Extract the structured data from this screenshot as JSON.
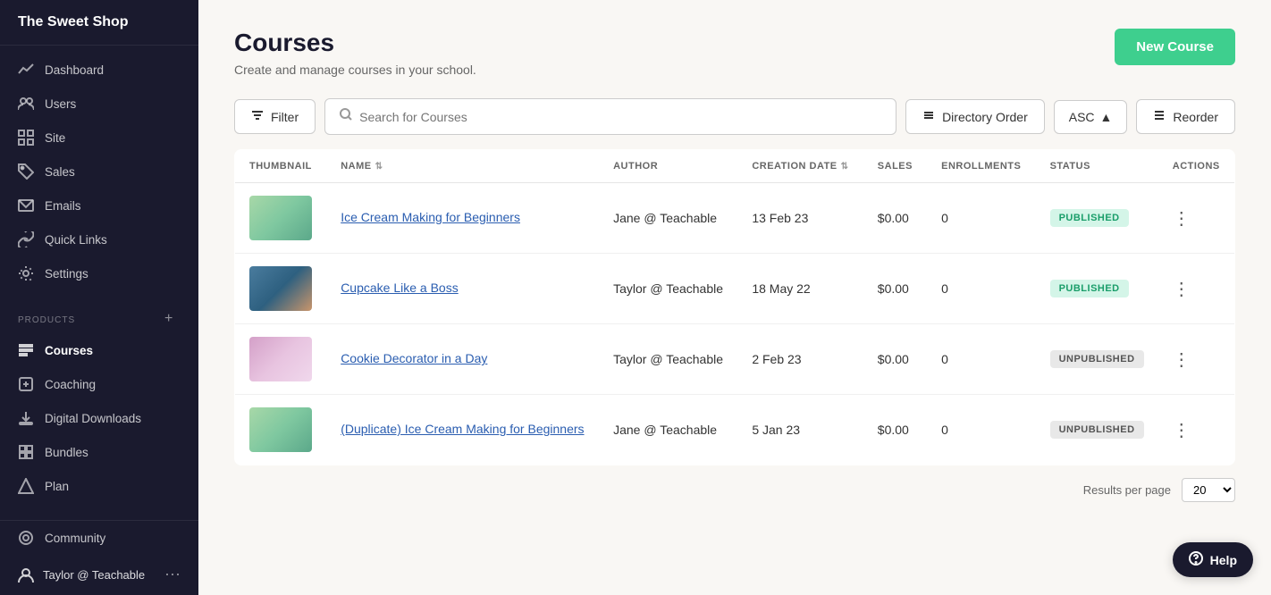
{
  "sidebar": {
    "logo": "The Sweet Shop",
    "nav_items": [
      {
        "id": "dashboard",
        "label": "Dashboard",
        "icon": "chart-line"
      },
      {
        "id": "users",
        "label": "Users",
        "icon": "users"
      },
      {
        "id": "site",
        "label": "Site",
        "icon": "grid"
      },
      {
        "id": "sales",
        "label": "Sales",
        "icon": "tag"
      },
      {
        "id": "emails",
        "label": "Emails",
        "icon": "email"
      },
      {
        "id": "quick-links",
        "label": "Quick Links",
        "icon": "link"
      },
      {
        "id": "settings",
        "label": "Settings",
        "icon": "gear"
      }
    ],
    "products_label": "PRODUCTS",
    "products_items": [
      {
        "id": "courses",
        "label": "Courses",
        "icon": "courses",
        "active": true
      },
      {
        "id": "coaching",
        "label": "Coaching",
        "icon": "coaching"
      },
      {
        "id": "digital-downloads",
        "label": "Digital Downloads",
        "icon": "download"
      },
      {
        "id": "bundles",
        "label": "Bundles",
        "icon": "bundle"
      },
      {
        "id": "plan",
        "label": "Plan",
        "icon": "plan"
      }
    ],
    "community_label": "Community",
    "user_name": "Taylor @ Teachable"
  },
  "page": {
    "title": "Courses",
    "subtitle": "Create and manage courses in your school.",
    "new_course_label": "New Course"
  },
  "filters": {
    "filter_label": "Filter",
    "search_placeholder": "Search for Courses",
    "directory_order_label": "Directory Order",
    "asc_label": "ASC",
    "reorder_label": "Reorder"
  },
  "table": {
    "columns": [
      "THUMBNAIL",
      "NAME",
      "AUTHOR",
      "CREATION DATE",
      "SALES",
      "ENROLLMENTS",
      "STATUS",
      "ACTIONS"
    ],
    "rows": [
      {
        "id": 1,
        "thumbnail_class": "thumbnail-ice1",
        "name": "Ice Cream Making for Beginners",
        "author": "Jane @ Teachable",
        "creation_date": "13 Feb 23",
        "sales": "$0.00",
        "enrollments": "0",
        "status": "PUBLISHED",
        "status_class": "badge-published"
      },
      {
        "id": 2,
        "thumbnail_class": "thumbnail-cupcake",
        "name": "Cupcake Like a Boss",
        "author": "Taylor @ Teachable",
        "creation_date": "18 May 22",
        "sales": "$0.00",
        "enrollments": "0",
        "status": "PUBLISHED",
        "status_class": "badge-published"
      },
      {
        "id": 3,
        "thumbnail_class": "thumbnail-cookie",
        "name": "Cookie Decorator in a Day",
        "author": "Taylor @ Teachable",
        "creation_date": "2 Feb 23",
        "sales": "$0.00",
        "enrollments": "0",
        "status": "UNPUBLISHED",
        "status_class": "badge-unpublished"
      },
      {
        "id": 4,
        "thumbnail_class": "thumbnail-ice2",
        "name": "(Duplicate) Ice Cream Making for Beginners",
        "author": "Jane @ Teachable",
        "creation_date": "5 Jan 23",
        "sales": "$0.00",
        "enrollments": "0",
        "status": "UNPUBLISHED",
        "status_class": "badge-unpublished"
      }
    ]
  },
  "footer": {
    "per_page_value": "20"
  },
  "help": {
    "label": "Help"
  }
}
